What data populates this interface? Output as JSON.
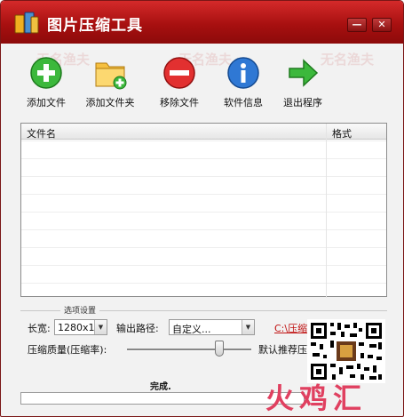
{
  "window": {
    "title": "图片压缩工具",
    "minimize_label": "—",
    "close_label": "✕",
    "accent_color": "#b01818"
  },
  "toolbar": {
    "items": [
      {
        "label": "添加文件",
        "icon": "add-icon"
      },
      {
        "label": "添加文件夹",
        "icon": "add-folder-icon"
      },
      {
        "label": "移除文件",
        "icon": "remove-icon"
      },
      {
        "label": "软件信息",
        "icon": "info-icon"
      },
      {
        "label": "退出程序",
        "icon": "exit-arrow-icon"
      }
    ]
  },
  "file_list": {
    "columns": [
      "文件名",
      "格式"
    ],
    "rows": []
  },
  "settings": {
    "group_title": "选项设置",
    "width_label": "长宽:",
    "width_value": "1280x1",
    "output_label": "输出路径:",
    "output_value": "自定义...",
    "output_path": "C:\\压缩",
    "quality_label": "压缩质量(压缩率):",
    "quality_fraction": 0.74,
    "recommend_label": "默认推荐压"
  },
  "status": {
    "text": "完成.",
    "progress": 0
  },
  "watermark": {
    "text": "无名渔夫"
  },
  "brand": {
    "text": "火鸡汇"
  }
}
